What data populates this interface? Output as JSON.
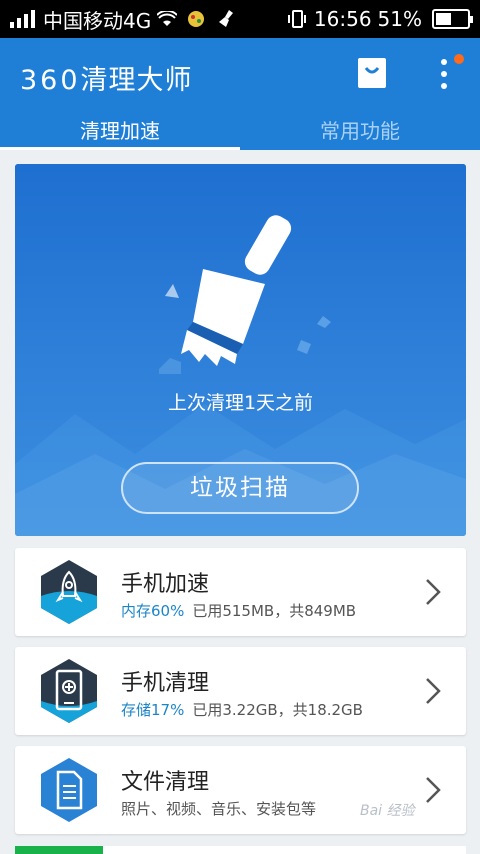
{
  "status_bar": {
    "carrier": "中国移动4G",
    "time": "16:56",
    "battery": "51%",
    "battery_level": 0.51
  },
  "app": {
    "logo_number": "360",
    "logo_text": "清理大师",
    "tabs": [
      {
        "label": "清理加速",
        "active": true
      },
      {
        "label": "常用功能",
        "active": false
      }
    ]
  },
  "hero": {
    "last_clean": "上次清理1天之前",
    "scan_button": "垃圾扫描"
  },
  "list": [
    {
      "title": "手机加速",
      "pct": "内存60%",
      "detail": "已用515MB，共849MB",
      "icon": "rocket-icon"
    },
    {
      "title": "手机清理",
      "pct": "存储17%",
      "detail": "已用3.22GB，共18.2GB",
      "icon": "phone-storage-icon"
    },
    {
      "title": "文件清理",
      "pct": "",
      "detail": "照片、视频、音乐、安装包等",
      "icon": "document-icon"
    }
  ],
  "watermark": "Bai 经验",
  "colors": {
    "header": "#1f7fd6",
    "hero": "#2a7bd4",
    "accent_text": "#1b86c7",
    "notification": "#ff6b1a"
  }
}
